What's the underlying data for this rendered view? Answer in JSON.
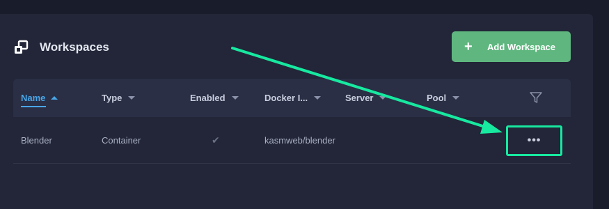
{
  "header": {
    "title": "Workspaces",
    "icon": "windows-stack-icon"
  },
  "add_button": {
    "plus": "+",
    "label": "Add Workspace"
  },
  "table": {
    "columns": [
      {
        "key": "name",
        "label": "Name",
        "sort": "ascending"
      },
      {
        "key": "type",
        "label": "Type"
      },
      {
        "key": "enabled",
        "label": "Enabled"
      },
      {
        "key": "docker_image",
        "label": "Docker I..."
      },
      {
        "key": "server",
        "label": "Server"
      },
      {
        "key": "pool",
        "label": "Pool"
      }
    ],
    "rows": [
      {
        "name": "Blender",
        "type": "Container",
        "enabled": "✔",
        "docker_image": "kasmweb/blender",
        "server": "",
        "pool": ""
      }
    ],
    "row_menu_label": "•••"
  },
  "colors": {
    "background": "#191c2b",
    "panel": "#222638",
    "accent_green": "#5fb77f",
    "sort_blue": "#49a6e8",
    "annotation": "#17e9a0"
  }
}
